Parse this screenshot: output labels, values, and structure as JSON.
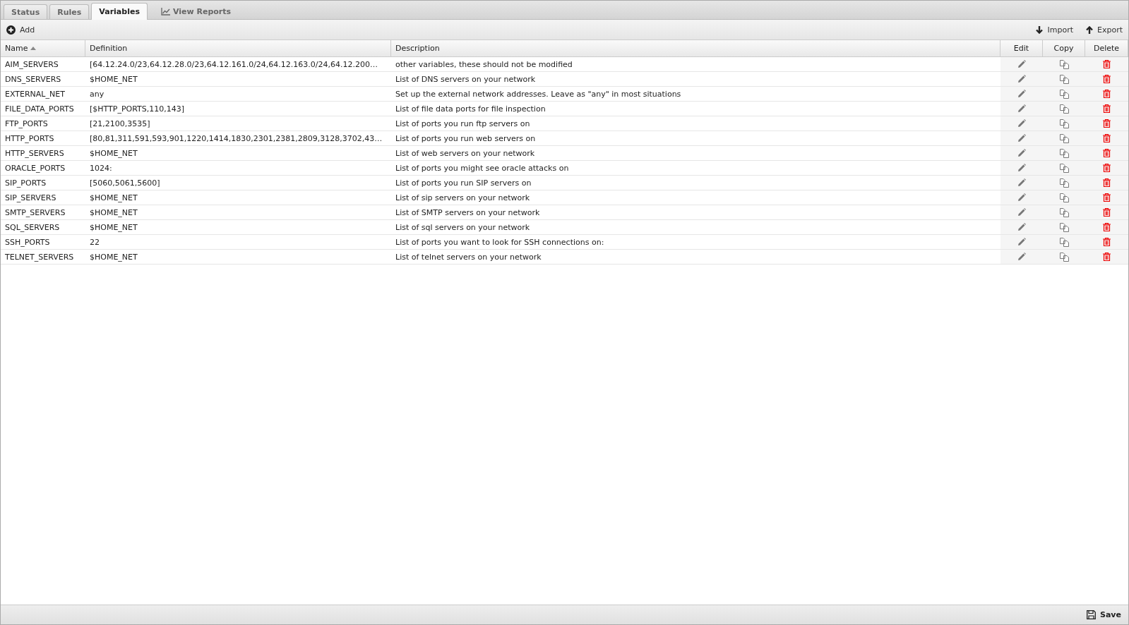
{
  "tabs": [
    {
      "label": "Status",
      "kind": "tab",
      "selected": false
    },
    {
      "label": "Rules",
      "kind": "tab",
      "selected": false
    },
    {
      "label": "Variables",
      "kind": "tab",
      "selected": true
    },
    {
      "label": "View Reports",
      "kind": "link",
      "selected": false
    }
  ],
  "toolbar": {
    "add": "Add",
    "import": "Import",
    "export": "Export"
  },
  "table": {
    "columns": [
      {
        "label": "Name",
        "sorted": true
      },
      {
        "label": "Definition",
        "sorted": false
      },
      {
        "label": "Description",
        "sorted": false
      },
      {
        "label": "Edit",
        "sorted": false
      },
      {
        "label": "Copy",
        "sorted": false
      },
      {
        "label": "Delete",
        "sorted": false
      }
    ],
    "rows": [
      {
        "name": "AIM_SERVERS",
        "definition": "[64.12.24.0/23,64.12.28.0/23,64.12.161.0/24,64.12.163.0/24,64.12.200…",
        "description": "other variables, these should not be modified"
      },
      {
        "name": "DNS_SERVERS",
        "definition": "$HOME_NET",
        "description": "List of DNS servers on your network"
      },
      {
        "name": "EXTERNAL_NET",
        "definition": "any",
        "description": "Set up the external network addresses. Leave as \"any\" in most situations"
      },
      {
        "name": "FILE_DATA_PORTS",
        "definition": "[$HTTP_PORTS,110,143]",
        "description": "List of file data ports for file inspection"
      },
      {
        "name": "FTP_PORTS",
        "definition": "[21,2100,3535]",
        "description": "List of ports you run ftp servers on"
      },
      {
        "name": "HTTP_PORTS",
        "definition": "[80,81,311,591,593,901,1220,1414,1830,2301,2381,2809,3128,3702,43…",
        "description": "List of ports you run web servers on"
      },
      {
        "name": "HTTP_SERVERS",
        "definition": "$HOME_NET",
        "description": "List of web servers on your network"
      },
      {
        "name": "ORACLE_PORTS",
        "definition": "1024:",
        "description": "List of ports you might see oracle attacks on"
      },
      {
        "name": "SIP_PORTS",
        "definition": "[5060,5061,5600]",
        "description": "List of ports you run SIP servers on"
      },
      {
        "name": "SIP_SERVERS",
        "definition": "$HOME_NET",
        "description": "List of sip servers on your network"
      },
      {
        "name": "SMTP_SERVERS",
        "definition": "$HOME_NET",
        "description": "List of SMTP servers on your network"
      },
      {
        "name": "SQL_SERVERS",
        "definition": "$HOME_NET",
        "description": "List of sql servers on your network"
      },
      {
        "name": "SSH_PORTS",
        "definition": "22",
        "description": "List of ports you want to look for SSH connections on:"
      },
      {
        "name": "TELNET_SERVERS",
        "definition": "$HOME_NET",
        "description": "List of telnet servers on your network"
      }
    ]
  },
  "footer": {
    "save": "Save"
  }
}
